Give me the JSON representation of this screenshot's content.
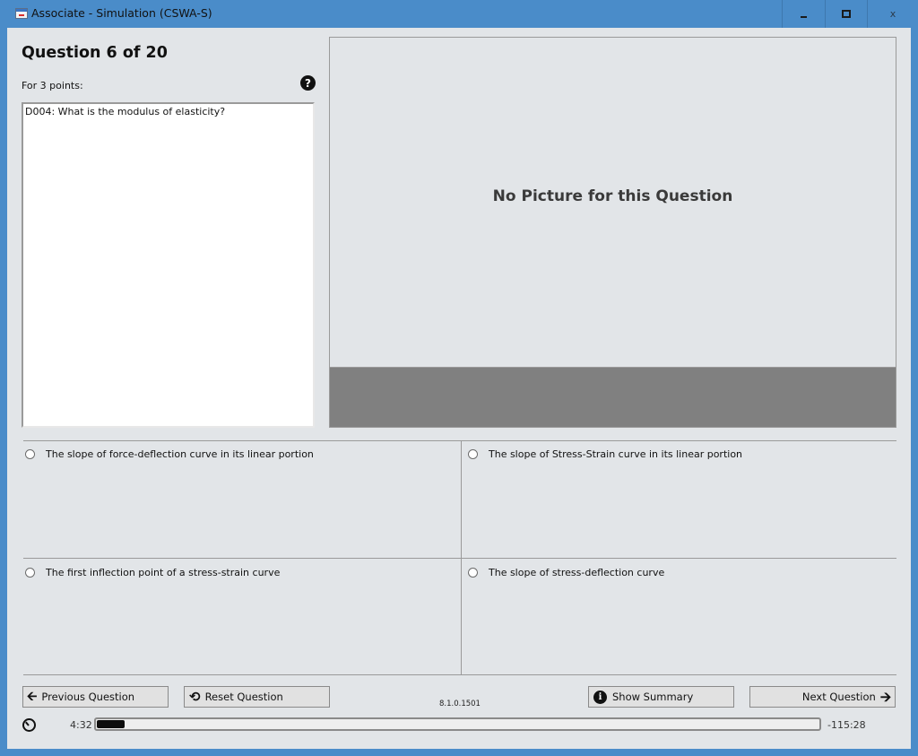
{
  "window": {
    "title": "Associate - Simulation (CSWA-S)",
    "controls": {
      "minimize": "minimize",
      "maximize": "maximize",
      "close": "x"
    }
  },
  "question": {
    "header": "Question 6 of 20",
    "points_label": "For 3 points:",
    "help_icon": "?",
    "text": "D004: What is the modulus of elasticity?"
  },
  "picture": {
    "placeholder": "No Picture for this Question"
  },
  "answers": [
    {
      "label": "The slope of force-deflection curve in its linear portion",
      "selected": false
    },
    {
      "label": "The slope of Stress-Strain curve in its linear portion",
      "selected": false
    },
    {
      "label": "The first inflection point of a stress-strain curve",
      "selected": false
    },
    {
      "label": "The slope of stress-deflection curve",
      "selected": false
    }
  ],
  "buttons": {
    "previous": "Previous Question",
    "reset": "Reset Question",
    "summary": "Show Summary",
    "next": "Next Question"
  },
  "icons": {
    "previous": "arrow-left-icon",
    "reset": "reset-icon",
    "summary": "info-icon",
    "next": "arrow-right-icon",
    "timer": "clock-icon"
  },
  "version": "8.1.0.1501",
  "timer": {
    "elapsed": "4:32",
    "remaining": "-115:28",
    "progress_fraction": 0.038
  }
}
